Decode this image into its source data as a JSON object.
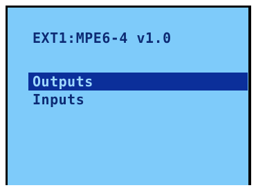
{
  "screen": {
    "title": "EXT1:MPE6-4 v1.0",
    "background_color": "#7ecbfa",
    "text_color": "#0d2b74",
    "highlight_color": "#0b2f9a"
  },
  "menu": {
    "selected_index": 0,
    "items": [
      {
        "label": "Outputs",
        "selected": true
      },
      {
        "label": "Inputs",
        "selected": false
      }
    ]
  }
}
